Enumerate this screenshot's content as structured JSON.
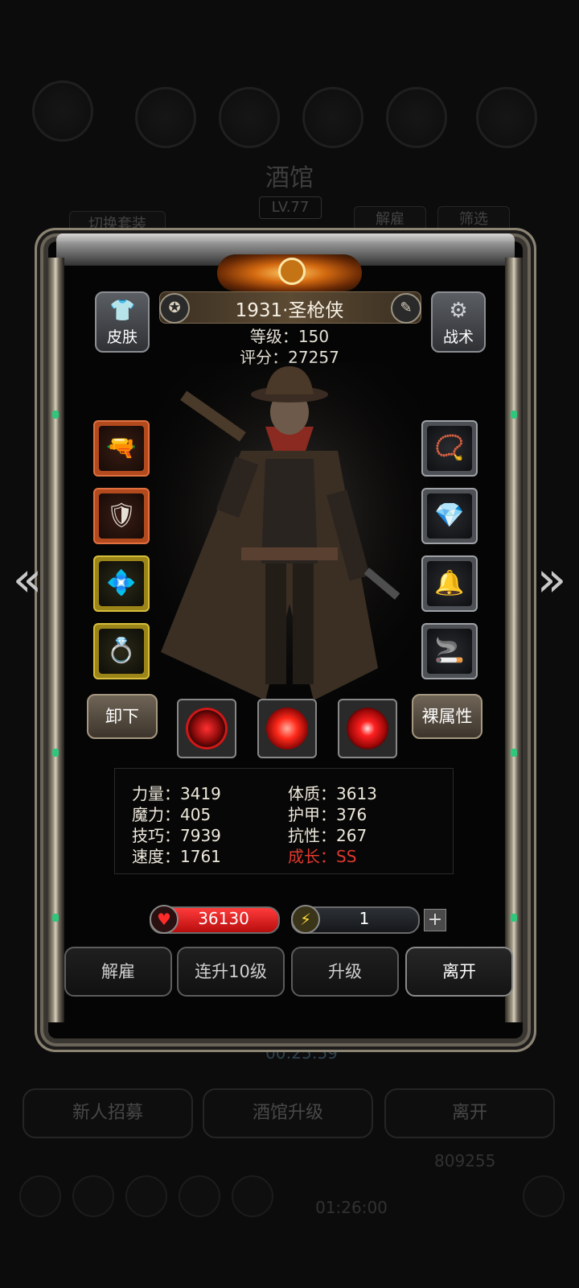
{
  "background": {
    "title": "酒馆",
    "level": "LV.77",
    "switch_outfit": "切换套装",
    "dismiss_tab": "解雇",
    "filter_tab": "筛选",
    "timer": "00:25:59",
    "buttons": [
      "新人招募",
      "酒馆升级",
      "离开"
    ],
    "gold": "809255",
    "timer2": "01:26:00"
  },
  "hero": {
    "name": "1931·圣枪侠",
    "level_line": "等级：150",
    "score_line": "评分：27257",
    "skin_label": "皮肤",
    "tactics_label": "战术"
  },
  "equipment_left": [
    {
      "name": "pistol-icon",
      "glyph": "🔫",
      "rarity": "red"
    },
    {
      "name": "armor-icon",
      "glyph": "🛡",
      "rarity": "red"
    },
    {
      "name": "bracelet-icon",
      "glyph": "💠",
      "rarity": "gold"
    },
    {
      "name": "ring-icon",
      "glyph": "💍",
      "rarity": "gold"
    }
  ],
  "equipment_right": [
    {
      "name": "necklace-icon",
      "glyph": "📿",
      "rarity": "gray"
    },
    {
      "name": "gem-icon",
      "glyph": "💎",
      "rarity": "gray"
    },
    {
      "name": "bell-icon",
      "glyph": "🔔",
      "rarity": "gray"
    },
    {
      "name": "pipe-icon",
      "glyph": "🚬",
      "rarity": "gray"
    }
  ],
  "actions": {
    "unequip": "卸下",
    "base_attributes": "裸属性"
  },
  "stats": {
    "strength": "力量：3419",
    "magic": "魔力：405",
    "skill": "技巧：7939",
    "speed": "速度：1761",
    "constitution": "体质：3613",
    "armor": "护甲：376",
    "resistance": "抗性：267",
    "growth": "成长：SS"
  },
  "resources": {
    "hp": "36130",
    "energy": "1",
    "plus": "+"
  },
  "bottom_buttons": {
    "dismiss": "解雇",
    "level_up_10": "连升10级",
    "level_up": "升级",
    "leave": "离开"
  },
  "colors": {
    "growth_red": "#e0382e",
    "hp_red": "#d11818",
    "energy_yellow": "#ffd83a"
  }
}
